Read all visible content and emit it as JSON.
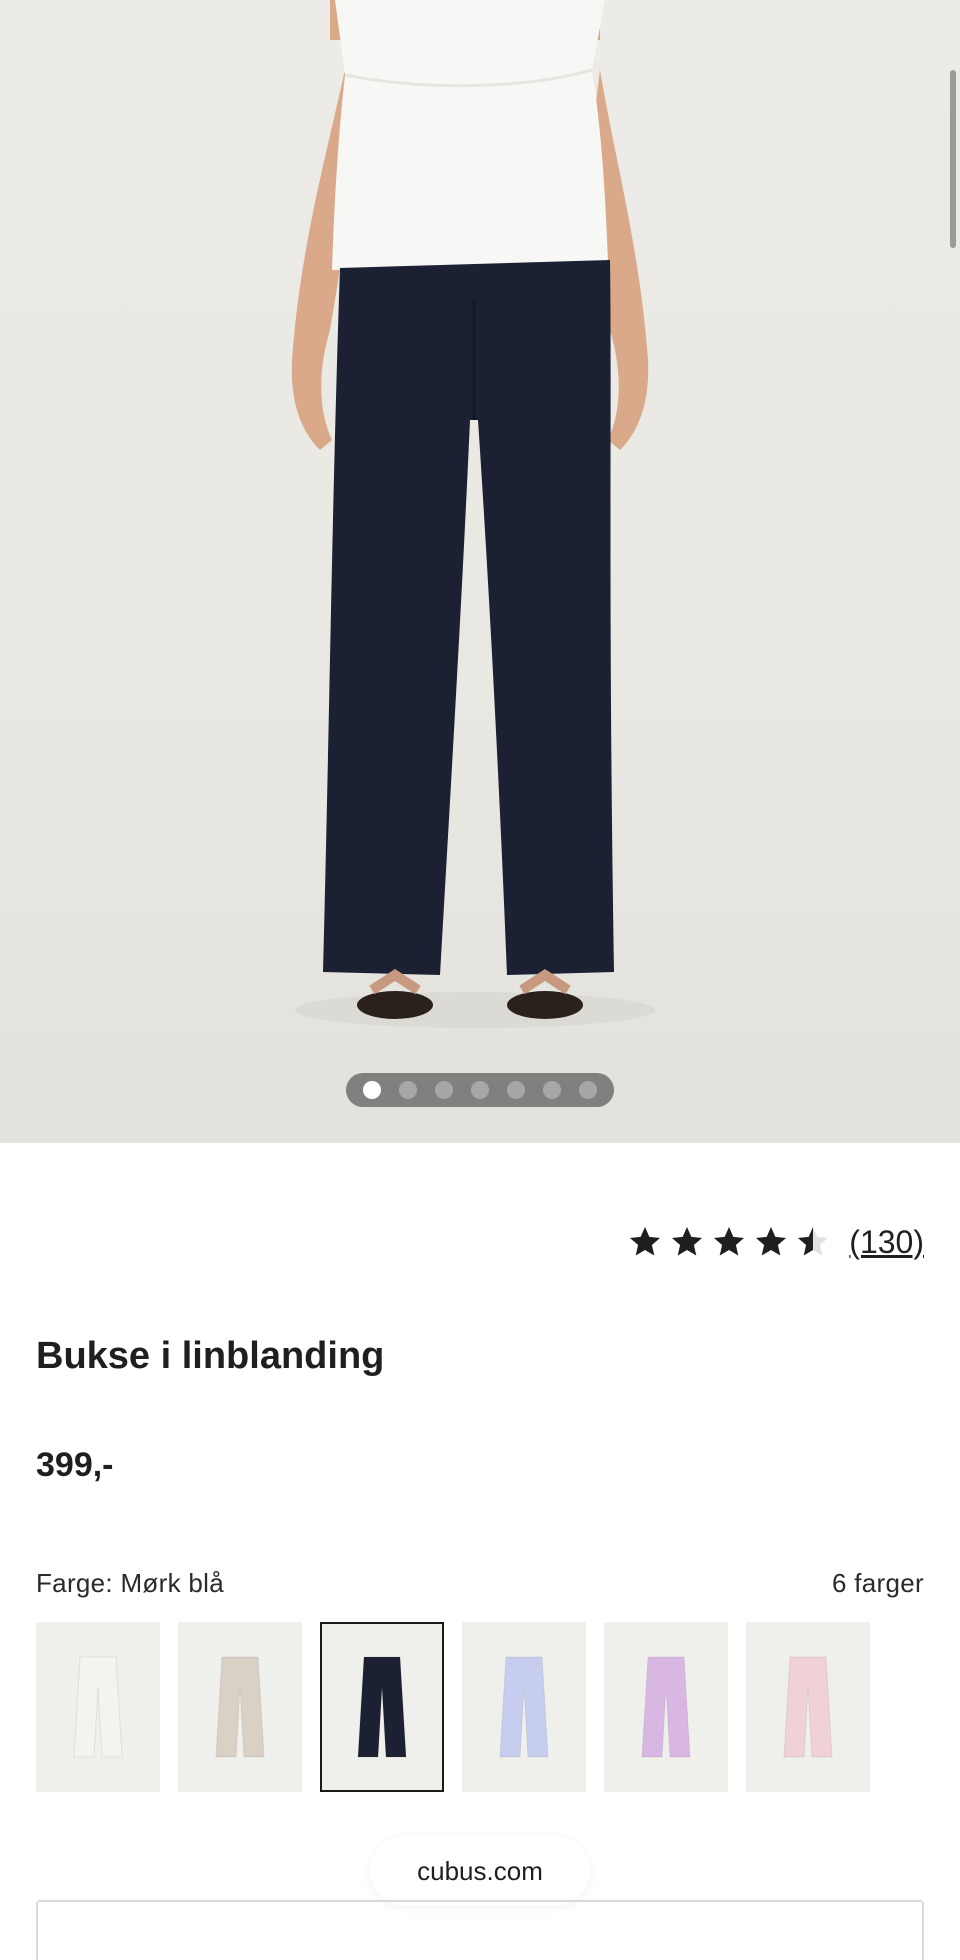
{
  "gallery": {
    "image_alt": "Bukse i linblanding",
    "dot_count": 7,
    "active_index": 0
  },
  "rating": {
    "value_fraction_stars": 4.5,
    "max_stars": 5,
    "count_label": "(130)"
  },
  "product": {
    "title": "Bukse i linblanding",
    "price": "399,-"
  },
  "color_selector": {
    "selected_label": "Farge: Mørk blå",
    "count_label": "6 farger",
    "swatches": [
      {
        "color": "#f4f3ef",
        "selected": false
      },
      {
        "color": "#d9d1c6",
        "selected": false
      },
      {
        "color": "#1b2033",
        "selected": true
      },
      {
        "color": "#c7cdee",
        "selected": false
      },
      {
        "color": "#d9b7e3",
        "selected": false
      },
      {
        "color": "#f0d2d6",
        "selected": false
      }
    ]
  },
  "browser": {
    "url": "cubus.com"
  },
  "colors": {
    "pants_navy": "#1b2033",
    "top_white": "#f7f7f5",
    "skin": "#d9a989",
    "text_dark": "#1f1f1f"
  }
}
